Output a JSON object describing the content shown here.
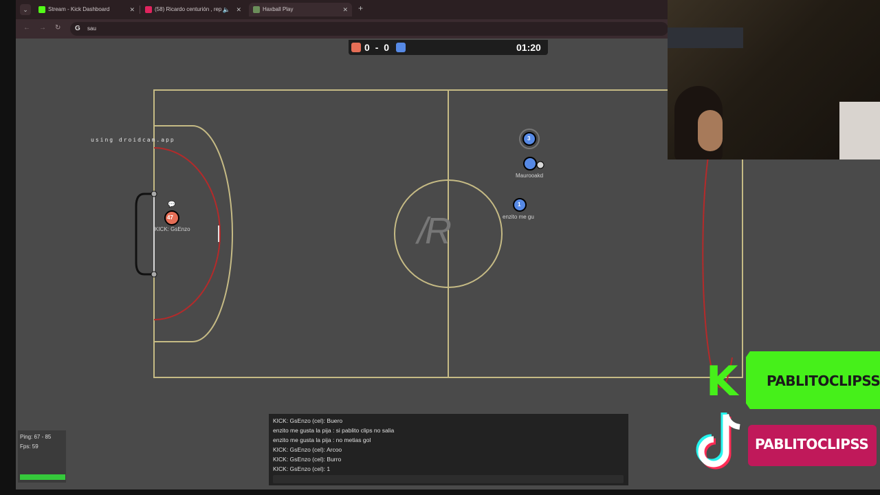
{
  "browser": {
    "tabs": [
      {
        "title": "Stream - Kick Dashboard",
        "favicon_color": "#53fc18"
      },
      {
        "title": "(58) Ricardo centurión , rep",
        "favicon_color": "#e0245e"
      },
      {
        "title": "Haxball Play",
        "favicon_color": "#6b8e5a"
      }
    ],
    "address": "sau",
    "new_tab_label": "+"
  },
  "scoreboard": {
    "red_score": "0",
    "separator": "-",
    "blue_score": "0",
    "time": "01:20",
    "red_color": "#e56e56",
    "blue_color": "#5689e5"
  },
  "field": {
    "center_logo": "/R",
    "players": [
      {
        "team": "red",
        "number": "47",
        "name": "KICK: GsEnzo",
        "chat_bubble": "💬"
      },
      {
        "team": "blue",
        "number": "3",
        "name": ""
      },
      {
        "team": "blue",
        "number": "",
        "name": "Maurooakd"
      },
      {
        "team": "blue",
        "number": "1",
        "name": "enzito  me gu"
      }
    ]
  },
  "stats": {
    "ping": "Ping: 67 - 85",
    "fps": "Fps: 59"
  },
  "chat": {
    "messages": [
      "KICK: GsEnzo (cel): Buero",
      "enzito me gusta la pija : si pablito clips no salia",
      "enzito me gusta la pija : no metias gol",
      "KICK: GsEnzo (cel): Arcoo",
      "KICK: GsEnzo (cel): Burro",
      "KICK: GsEnzo (cel): 1"
    ]
  },
  "webcam": {
    "watermark": "using droidcam.app"
  },
  "overlays": {
    "kick_handle": "PABLITOCLIPSS",
    "kick_logo": "K",
    "tiktok_handle": "PABLITOCLIPSS",
    "kick_color": "#46f01a",
    "tiktok_color": "#c0195a"
  }
}
